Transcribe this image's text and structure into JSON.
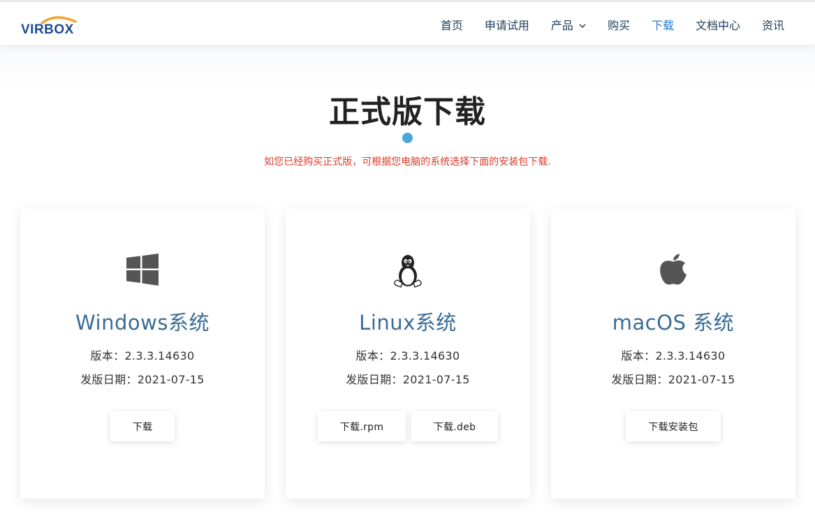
{
  "brand": {
    "logo_text": "VIRBOX",
    "logo_color": "#1d4b8f",
    "arc_color": "#f3a22c"
  },
  "nav": {
    "items": [
      {
        "label": "首页"
      },
      {
        "label": "申请试用"
      },
      {
        "label": "产品"
      },
      {
        "label": "购买"
      },
      {
        "label": "下载"
      },
      {
        "label": "文档中心"
      },
      {
        "label": "资讯"
      }
    ],
    "active": "下载"
  },
  "page": {
    "title": "正式版下载",
    "subtitle": "如您已经购买正式版，可根据您电脑的系统选择下面的安装包下载."
  },
  "cards": [
    {
      "icon": "windows-icon",
      "name": "Windows系统",
      "version_line": "版本：2.3.3.14630",
      "date_line": "发版日期：2021-07-15",
      "buttons": [
        "下载"
      ]
    },
    {
      "icon": "linux-tux-icon",
      "name": "Linux系统",
      "version_line": "版本：2.3.3.14630",
      "date_line": "发版日期：2021-07-15",
      "buttons": [
        "下载.rpm",
        "下载.deb"
      ]
    },
    {
      "icon": "apple-icon",
      "name": "macOS 系统",
      "version_line": "版本：2.3.3.14630",
      "date_line": "发版日期：2021-07-15",
      "buttons": [
        "下载安装包"
      ]
    }
  ],
  "colors": {
    "accent_blue": "#2b7bd0",
    "card_title": "#3a6c96",
    "notice_red": "#d93a2b",
    "dot": "#4aa7d6"
  }
}
